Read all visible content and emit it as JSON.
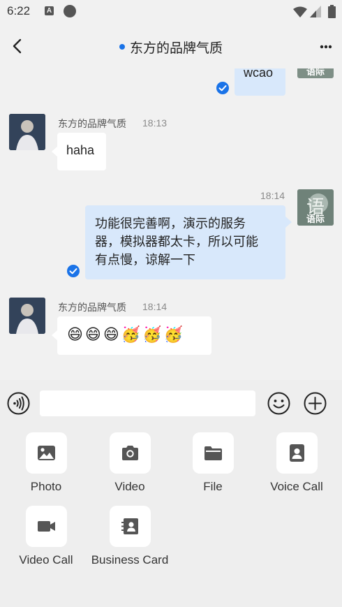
{
  "status_bar": {
    "time": "6:22",
    "notif_letter": "A"
  },
  "header": {
    "title": "东方的品牌气质"
  },
  "messages": {
    "m1": {
      "text": "wcao"
    },
    "m2": {
      "sender": "东方的品牌气质",
      "time": "18:13",
      "text": "haha"
    },
    "m3": {
      "time": "18:14",
      "line1": "功能很完善啊，演示的服务",
      "line2": "器，模拟器都太卡，所以可能",
      "line3": "有点慢，谅解一下"
    },
    "m4": {
      "sender": "东方的品牌气质",
      "time": "18:14",
      "emojis": "😄😄😄🥳🥳🥳"
    }
  },
  "self_avatar_text": "语际",
  "input": {
    "value": "",
    "placeholder": ""
  },
  "actions": [
    {
      "label": "Photo",
      "icon": "photo-icon"
    },
    {
      "label": "Video",
      "icon": "camera-icon"
    },
    {
      "label": "File",
      "icon": "folder-icon"
    },
    {
      "label": "Voice Call",
      "icon": "voice-call-icon"
    },
    {
      "label": "Video Call",
      "icon": "video-call-icon"
    },
    {
      "label": "Business Card",
      "icon": "business-card-icon"
    }
  ],
  "colors": {
    "accent": "#1a73e8",
    "bubble_out": "#d8e8fb",
    "bubble_in": "#ffffff",
    "background": "#f1f1f1"
  }
}
